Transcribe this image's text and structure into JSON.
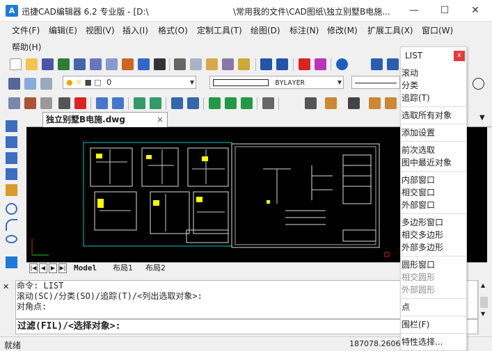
{
  "window": {
    "app_title": "迅捷CAD编辑器 6.2 专业版 - [D:\\",
    "doc_path": "\\常用我的文件\\CAD图纸\\独立别墅B电施...",
    "logo_text": "A",
    "minimize": "—",
    "maximize": "☐",
    "close": "✕"
  },
  "menu": {
    "items": [
      "文件(F)",
      "编辑(E)",
      "视图(V)",
      "插入(I)",
      "格式(O)",
      "定制工具(T)",
      "绘图(D)",
      "标注(N)",
      "修改(M)",
      "扩展工具(X)",
      "窗口(W)"
    ],
    "help": "帮助(H)"
  },
  "toolbar": {
    "layer_value": "0",
    "linetype_value": "BYLAYER"
  },
  "document": {
    "tab_label": "独立别墅B电施.dwg",
    "tab_close": "×"
  },
  "layouts": {
    "model": "Model",
    "layout1": "布局1",
    "layout2": "布局2"
  },
  "command": {
    "lines": [
      "命令:  LIST",
      "滚动(SC)/分类(SO)/追踪(T)/<列出选取对象>:",
      "对角点:"
    ],
    "prompt": "过滤(FIL)/<选择对象>:"
  },
  "status": {
    "text": "就绪",
    "coords": "187078.2606,1"
  },
  "popup": {
    "title": "LIST",
    "close": "x",
    "items": [
      {
        "label": "滚动",
        "dim": false
      },
      {
        "label": "分类",
        "dim": false
      },
      {
        "label": "追踪(T)",
        "dim": false
      },
      {
        "label": "选取所有对象",
        "dim": false
      },
      {
        "label": "添加设置",
        "dim": false
      },
      {
        "label": "前次选取",
        "dim": false
      },
      {
        "label": "图中最近对象",
        "dim": false
      },
      {
        "label": "内部窗口",
        "dim": false
      },
      {
        "label": "相交窗口",
        "dim": false
      },
      {
        "label": "外部窗口",
        "dim": false
      },
      {
        "label": "多边形窗口",
        "dim": false
      },
      {
        "label": "相交多边形",
        "dim": false
      },
      {
        "label": "外部多边形",
        "dim": false
      },
      {
        "label": "圆形窗口",
        "dim": false
      },
      {
        "label": "相交圆形",
        "dim": true
      },
      {
        "label": "外部圆形",
        "dim": true
      },
      {
        "label": "点",
        "dim": false
      },
      {
        "label": "围栏(F)",
        "dim": false
      },
      {
        "label": "特性选择...",
        "dim": false
      }
    ]
  },
  "colors": {
    "accent": "#1e7ad6",
    "canvas": "#000000",
    "drawing_frame": "#00c8c8",
    "highlight": "#ffff00",
    "popup_close": "#e53a3a"
  }
}
